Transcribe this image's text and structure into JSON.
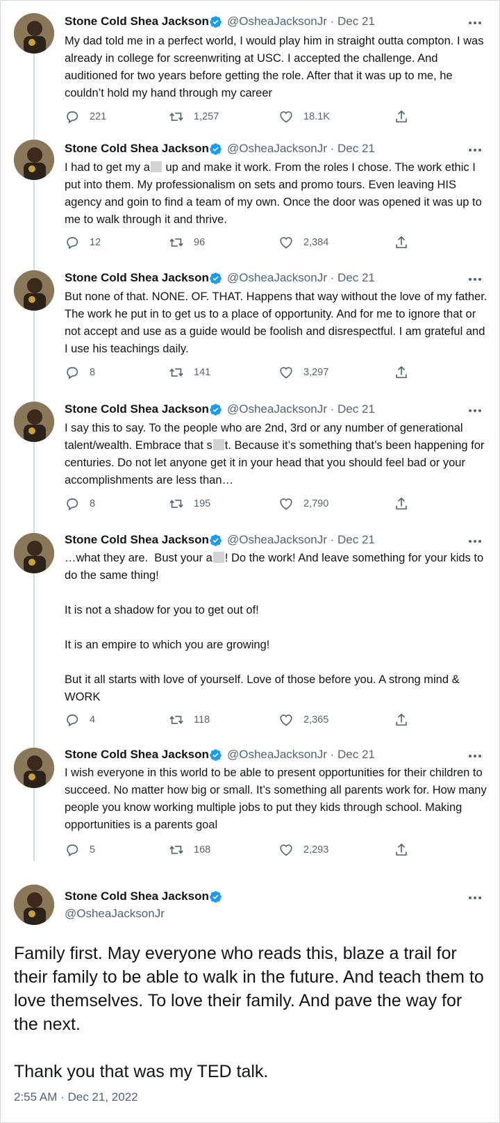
{
  "colors": {
    "accent": "#1d9bf0",
    "text": "#0f1419",
    "secondary": "#536471",
    "border": "#cfd9de"
  },
  "thread": [
    {
      "name": "Stone Cold Shea Jackson",
      "handle": "@OsheaJacksonJr",
      "date": "Dec 21",
      "segments": [
        "My dad told me in a perfect world, I would play him in straight outta compton. I was already in college for screenwriting at USC. I accepted the challenge. And auditioned for two years before getting the role. After that it was up to me, he couldn’t hold my hand through my career"
      ],
      "replies": "221",
      "retweets": "1,257",
      "likes": "18.1K"
    },
    {
      "name": "Stone Cold Shea Jackson",
      "handle": "@OsheaJacksonJr",
      "date": "Dec 21",
      "segments": [
        "I had to get my a",
        " up and make it work. From the roles I chose. The work ethic I put into them. My professionalism on sets and promo tours. Even leaving HIS agency and goin to find a team of my own. Once the door was opened it was up to me to walk through it and thrive."
      ],
      "replies": "12",
      "retweets": "96",
      "likes": "2,384"
    },
    {
      "name": "Stone Cold Shea Jackson",
      "handle": "@OsheaJacksonJr",
      "date": "Dec 21",
      "segments": [
        "But none of that. NONE. OF. THAT. Happens that way without the love of my father. The work he put in to get us to a place of opportunity. And for me to ignore that or not accept and use as a guide would be foolish and disrespectful. I am grateful and I use his teachings daily."
      ],
      "replies": "8",
      "retweets": "141",
      "likes": "3,297"
    },
    {
      "name": "Stone Cold Shea Jackson",
      "handle": "@OsheaJacksonJr",
      "date": "Dec 21",
      "segments": [
        "I say this to say. To the people who are 2nd, 3rd or any number of generational talent/wealth. Embrace that s",
        "t. Because it’s something that’s been happening for centuries. Do not let anyone get it in your head that you should feel bad or your accomplishments are less than…"
      ],
      "replies": "8",
      "retweets": "195",
      "likes": "2,790"
    },
    {
      "name": "Stone Cold Shea Jackson",
      "handle": "@OsheaJacksonJr",
      "date": "Dec 21",
      "segments": [
        "…what they are.  Bust your a",
        "! Do the work! And leave something for your kids to do the same thing!\n\nIt is not a shadow for you to get out of!\n\nIt is an empire to which you are growing!\n\nBut it all starts with love of yourself. Love of those before you. A strong mind & WORK"
      ],
      "replies": "4",
      "retweets": "118",
      "likes": "2,365"
    },
    {
      "name": "Stone Cold Shea Jackson",
      "handle": "@OsheaJacksonJr",
      "date": "Dec 21",
      "segments": [
        "I wish everyone in this world to be able to present opportunities for their children to succeed. No matter how big or small. It’s something all parents work for. How many people you know working multiple jobs to put they kids through school. Making opportunities is a parents goal"
      ],
      "replies": "5",
      "retweets": "168",
      "likes": "2,293"
    }
  ],
  "main_tweet": {
    "name": "Stone Cold Shea Jackson",
    "handle": "@OsheaJacksonJr",
    "text": "Family first. May everyone who reads this, blaze a trail for their family to be able to walk in the future. And teach them to love themselves. To love their family. And pave the way for the next.\n\nThank you that was my TED talk.",
    "timestamp": "2:55 AM · Dec 21, 2022"
  }
}
